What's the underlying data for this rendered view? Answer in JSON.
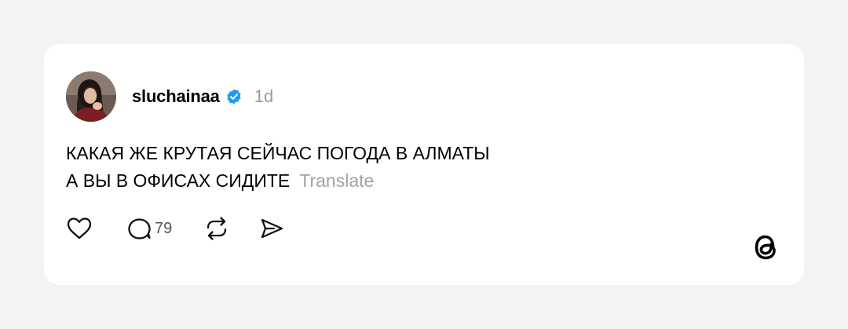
{
  "post": {
    "author": {
      "username": "sluchainaa",
      "verified": true,
      "avatar_icon": "avatar-photo"
    },
    "timestamp": "1d",
    "text_lines": [
      "КАКАЯ ЖЕ КРУТАЯ СЕЙЧАС ПОГОДА В АЛМАТЫ",
      "А ВЫ В ОФИСАХ СИДИТЕ"
    ],
    "translate_label": "Translate",
    "actions": {
      "like_icon": "heart-icon",
      "reply_icon": "comment-icon",
      "reply_count": "79",
      "repost_icon": "repost-icon",
      "share_icon": "send-icon"
    }
  },
  "brand": {
    "logo_icon": "threads-logo-icon"
  },
  "colors": {
    "background": "#f3f3f3",
    "card": "#ffffff",
    "verified_blue": "#1d9bf0",
    "muted_text": "#9a9a9a"
  }
}
